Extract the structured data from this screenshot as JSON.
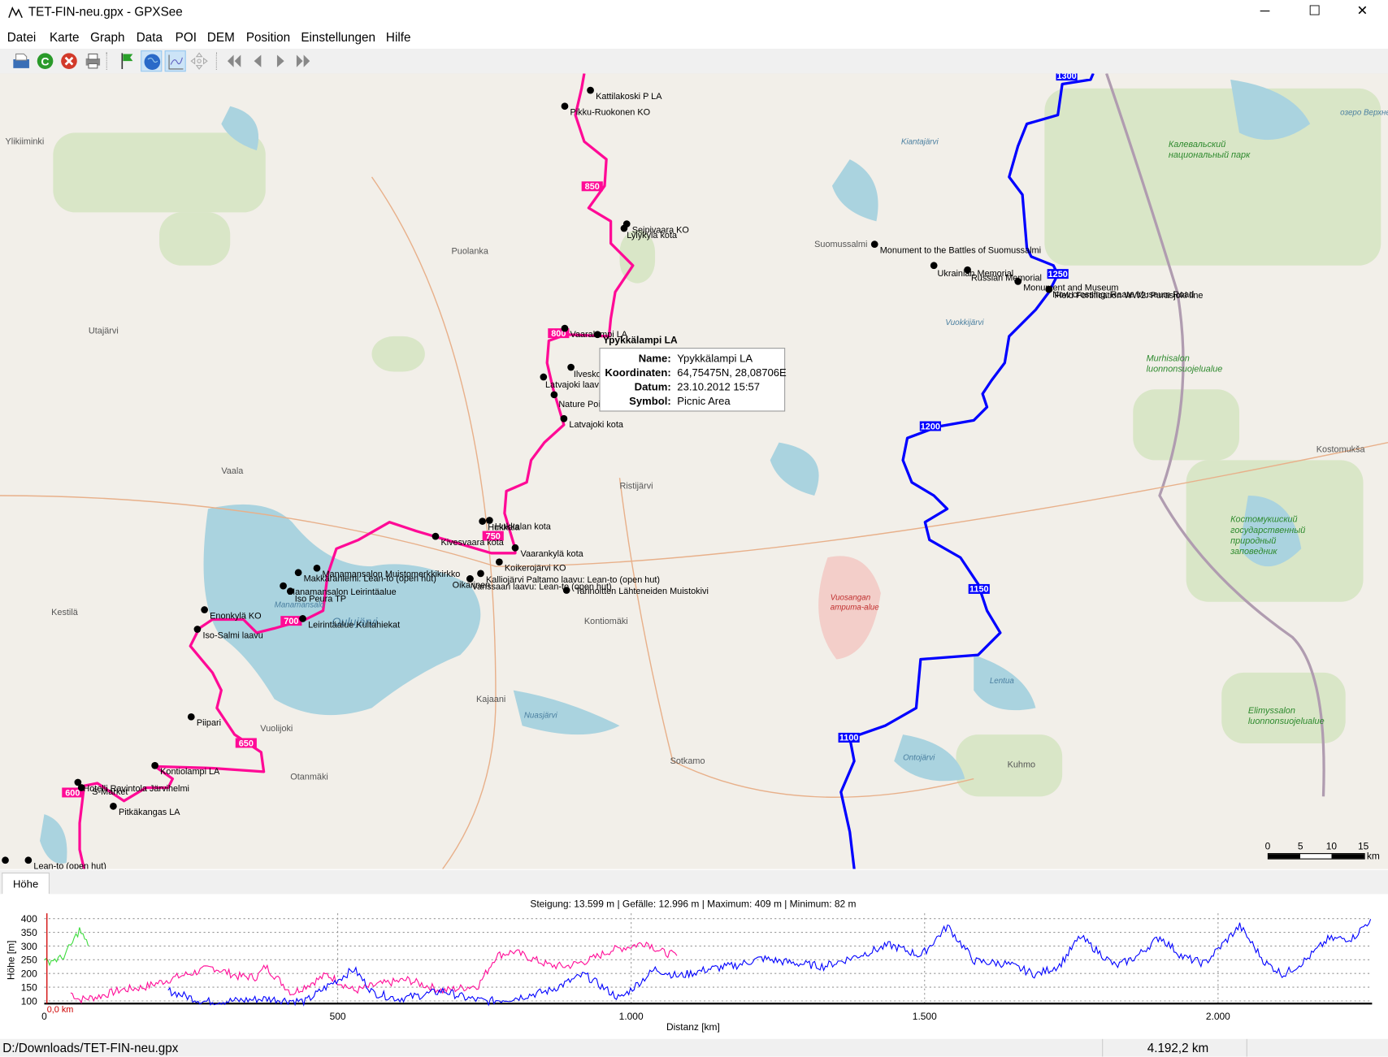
{
  "window": {
    "title": "TET-FIN-neu.gpx - GPXSee",
    "minimize": "─",
    "maximize": "☐",
    "close": "✕"
  },
  "menu": [
    "Datei",
    "Karte",
    "Graph",
    "Data",
    "POI",
    "DEM",
    "Position",
    "Einstellungen",
    "Hilfe"
  ],
  "toolbar": {
    "icons": [
      "open-file-icon",
      "reload-icon",
      "close-file-icon",
      "print-icon",
      "waypoints-flag-icon",
      "map-globe-icon",
      "graph-icon",
      "move-icon",
      "first-icon",
      "previous-icon",
      "next-icon",
      "last-icon"
    ]
  },
  "colors": {
    "track1": "#ff0a96",
    "track2": "#0000ff",
    "track3": "#3cdc3c",
    "map_bg": "#f2efe9",
    "water": "#aad3df",
    "forest": "#c8e0b0"
  },
  "map": {
    "places": [
      "Ylikiiminki",
      "Puolanka",
      "Utajärvi",
      "Vaala",
      "Kestilä",
      "Ristijärvi",
      "Kontiomäki",
      "Kajaani",
      "Vuolijoki",
      "Otanmäki",
      "Sotkamo",
      "Kuhmo",
      "Suomussalmi",
      "Kostomukša",
      "Vuokkijärvi",
      "Kiantajärvi",
      "Lentua",
      "Ontojärvi",
      "Nuasjärvi",
      "Oulujärvi",
      "Manamansalo",
      "Калевальский национальный парк",
      "Murhisalon luonnonsuojelualue",
      "Костомукшский государственный природный заповедник",
      "Elimyssalon luonnonsuojelualue",
      "Vuosangan ampuma-alue",
      "озеро Верхнее Куйто"
    ],
    "waypoints": [
      "Kattilakoski P LA",
      "Pikku-Ruokonen KO",
      "Seipivaara KO",
      "Lylykylä kota",
      "Monument to the Battles of Suomussalmi",
      "Ukrainian Memorial",
      "Russian Memorial",
      "Monument and Museum",
      "Field Fortification WW2: Purasjoki line",
      "Now crossing: Raate Museum Road",
      "Vaaralampi LA",
      "Ypykkälampi LA",
      "Ilveskoski",
      "Latvajoki laavu",
      "Nature Point Paljakka",
      "Latvajoki kota",
      "Hukkala",
      "Hukkalan kota",
      "Kivesvaara kota",
      "Vaarankylä kota",
      "Koikerojärvi KO",
      "Kalliojärvi Paltamo laavu: Lean-to (open hut)",
      "Oikarinen",
      "Vanssaari laavu: Lean-to (open hut)",
      "Tarinoitten Lähteneiden Muistokivi",
      "Manamansalon Muistomerkkikirkko",
      "Makkaraniemi: Lean-to (open hut)",
      "Manamansalon Leirintäalue",
      "Iso Peura TP",
      "Leirintäalue Kultahiekat",
      "Enonkylä KO",
      "Iso-Salmi laavu",
      "Piipari",
      "Kontiolampi LA",
      "Hotelli Ravintola Järvihelmi",
      "S-Market",
      "Pitkäkangas LA",
      "Lean-to (open hut)"
    ],
    "track1_markers": [
      "850",
      "800",
      "750",
      "700",
      "650",
      "600"
    ],
    "track2_markers": [
      "1300",
      "1250",
      "1200",
      "1150",
      "1100"
    ],
    "scale": {
      "ticks": [
        "0",
        "5",
        "10",
        "15"
      ],
      "unit": "km"
    },
    "tooltip": {
      "name_label": "Name:",
      "name": "Ypykkälampi LA",
      "coord_label": "Koordinaten:",
      "coord": "64,75475N, 28,08706E",
      "date_label": "Datum:",
      "date": "23.10.2012 15:57",
      "symbol_label": "Symbol:",
      "symbol": "Picnic Area"
    }
  },
  "tabs": {
    "elevation": "Höhe"
  },
  "chart_data": {
    "type": "line",
    "title": "Steigung: 13.599 m | Gefälle: 12.996 m | Maximum: 409 m | Minimum: 82 m",
    "xlabel": "Distanz [km]",
    "ylabel": "Höhe [m]",
    "xlim": [
      0,
      2260
    ],
    "ylim": [
      82,
      409
    ],
    "xticks": [
      "0",
      "500",
      "1.000",
      "1.500",
      "2.000"
    ],
    "yticks": [
      "100",
      "150",
      "200",
      "250",
      "300",
      "350",
      "400"
    ],
    "cursor_label": "0,0 km",
    "grid": true,
    "series": [
      {
        "name": "track1",
        "x": [
          45,
          60,
          90,
          130,
          170,
          226,
          287,
          330,
          362,
          377,
          422,
          482,
          528,
          570,
          619,
          679,
          740,
          770,
          800,
          830,
          860,
          890,
          930,
          966,
          1000,
          1026,
          1050,
          1078
        ],
        "y": [
          130,
          105,
          115,
          140,
          150,
          187,
          222,
          190,
          187,
          226,
          128,
          196,
          137,
          160,
          177,
          137,
          157,
          265,
          280,
          255,
          230,
          226,
          250,
          285,
          300,
          314,
          280,
          265
        ]
      },
      {
        "name": "track2",
        "x": [
          211,
          271,
          320,
          377,
          445,
          480,
          528,
          560,
          603,
          640,
          679,
          720,
          754,
          800,
          860,
          920,
          981,
          1041,
          1080,
          1132,
          1180,
          1222,
          1270,
          1328,
          1380,
          1441,
          1494,
          1539,
          1585,
          1640,
          1690,
          1730,
          1765,
          1826,
          1860,
          1901,
          1940,
          1977,
          2037,
          2080,
          2112,
          2150,
          2187,
          2230,
          2260
        ],
        "y": [
          137,
          98,
          100,
          108,
          98,
          150,
          216,
          130,
          108,
          120,
          137,
          110,
          98,
          110,
          137,
          196,
          108,
          216,
          190,
          216,
          230,
          255,
          240,
          226,
          260,
          304,
          265,
          373,
          245,
          235,
          196,
          230,
          334,
          226,
          260,
          334,
          260,
          236,
          373,
          240,
          196,
          250,
          324,
          330,
          398
        ]
      },
      {
        "name": "track3",
        "x": [
          0,
          15,
          30,
          45,
          60,
          75
        ],
        "y": [
          240,
          250,
          255,
          300,
          360,
          300
        ]
      }
    ]
  },
  "status": {
    "path": "D:/Downloads/TET-FIN-neu.gpx",
    "distance": "4.192,2 km"
  }
}
